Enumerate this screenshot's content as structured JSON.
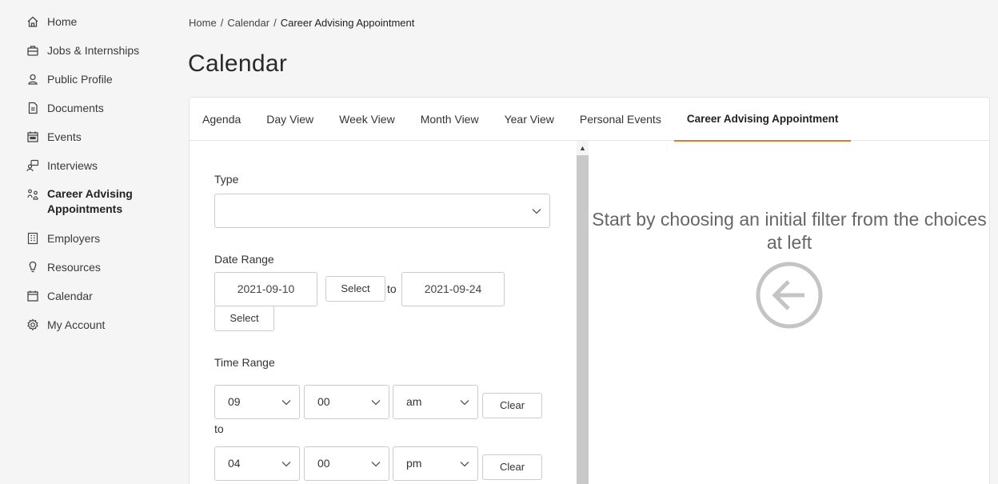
{
  "sidebar": {
    "items": [
      {
        "label": "Home",
        "icon": "home-icon"
      },
      {
        "label": "Jobs & Internships",
        "icon": "briefcase-icon"
      },
      {
        "label": "Public Profile",
        "icon": "user-icon"
      },
      {
        "label": "Documents",
        "icon": "document-icon"
      },
      {
        "label": "Events",
        "icon": "event-calendar-icon"
      },
      {
        "label": "Interviews",
        "icon": "interviews-icon"
      },
      {
        "label": "Career Advising Appointments",
        "icon": "advising-icon",
        "active": true
      },
      {
        "label": "Employers",
        "icon": "building-icon"
      },
      {
        "label": "Resources",
        "icon": "lightbulb-icon"
      },
      {
        "label": "Calendar",
        "icon": "calendar-icon"
      },
      {
        "label": "My Account",
        "icon": "gear-icon"
      }
    ]
  },
  "breadcrumb": {
    "home": "Home",
    "calendar": "Calendar",
    "current": "Career Advising Appointment",
    "separator": "/"
  },
  "page_title": "Calendar",
  "tabs": [
    {
      "label": "Agenda"
    },
    {
      "label": "Day View"
    },
    {
      "label": "Week View"
    },
    {
      "label": "Month View"
    },
    {
      "label": "Year View"
    },
    {
      "label": "Personal Events"
    },
    {
      "label": "Career Advising Appointment",
      "active": true
    }
  ],
  "form": {
    "type_label": "Type",
    "type_value": "",
    "date_range_label": "Date Range",
    "date_start": "2021-09-10",
    "date_end": "2021-09-24",
    "select_label": "Select",
    "to_label": "to",
    "time_range_label": "Time Range",
    "start_hour": "09",
    "start_minute": "00",
    "start_ampm": "am",
    "end_hour": "04",
    "end_minute": "00",
    "end_ampm": "pm",
    "clear_label": "Clear"
  },
  "right": {
    "prompt": "Start by choosing an initial filter from the choices at left"
  },
  "colors": {
    "accent": "#e87722",
    "scrollbar": "#c9c9c9"
  }
}
